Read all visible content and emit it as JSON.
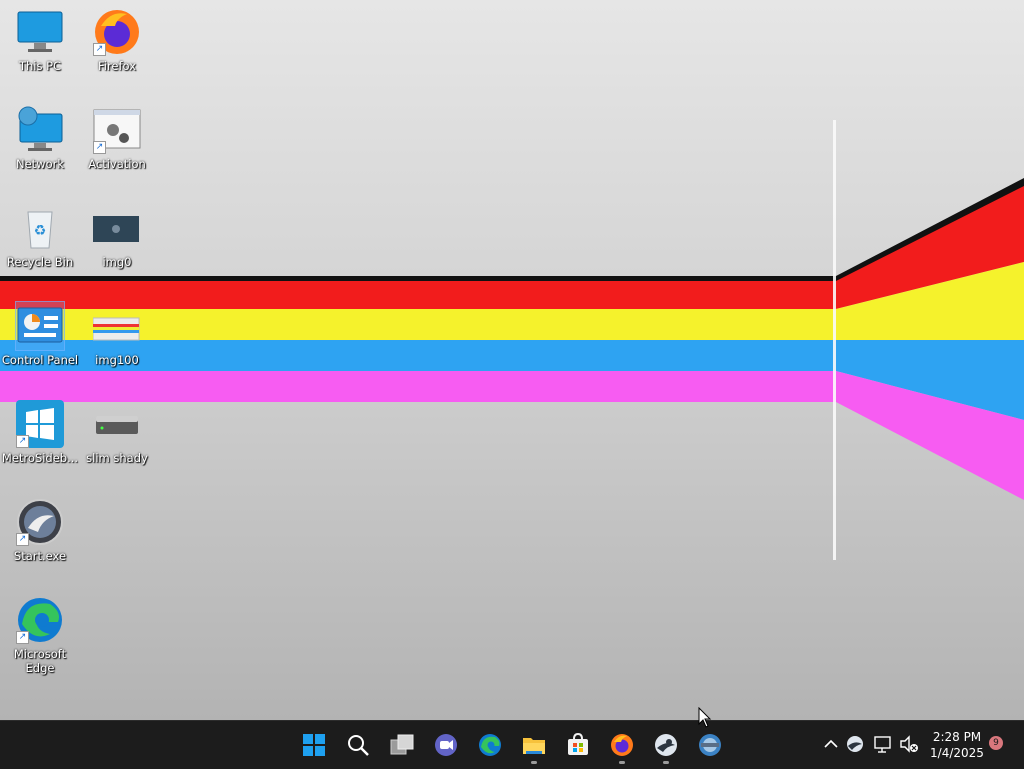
{
  "desktop": {
    "icons": [
      {
        "label": "This PC",
        "icon": "this-pc-icon"
      },
      {
        "label": "Firefox",
        "icon": "firefox-icon"
      },
      {
        "label": "Network",
        "icon": "network-icon"
      },
      {
        "label": "Activation",
        "icon": "activation-icon"
      },
      {
        "label": "Recycle Bin",
        "icon": "recycle-bin-icon"
      },
      {
        "label": "img0",
        "icon": "image-icon"
      },
      {
        "label": "Control Panel",
        "icon": "control-panel-icon"
      },
      {
        "label": "img100",
        "icon": "image-icon"
      },
      {
        "label": "MetroSideb...",
        "icon": "metro-sidebar-icon"
      },
      {
        "label": "slim shady",
        "icon": "drive-icon"
      },
      {
        "label": "Start.exe",
        "icon": "start-exe-icon"
      },
      {
        "label": "Microsoft Edge",
        "icon": "edge-icon"
      }
    ]
  },
  "taskbar": {
    "apps": [
      "start-icon",
      "search-icon",
      "task-view-icon",
      "teams-icon",
      "edge-icon",
      "file-explorer-icon",
      "store-icon",
      "firefox-icon",
      "steam-icon",
      "browser-icon"
    ],
    "clock": {
      "time": "2:28 PM",
      "date": "1/4/2025"
    },
    "notification_count": "9",
    "tray": [
      "chevron-up-icon",
      "steam-tray-icon",
      "network-icon",
      "volume-muted-icon"
    ]
  },
  "colors": {
    "red": "#f21c1c",
    "yellow": "#f5f22c",
    "blue": "#2ea3f2",
    "magenta": "#f75cf2",
    "taskbar": "#1c1c1c"
  }
}
